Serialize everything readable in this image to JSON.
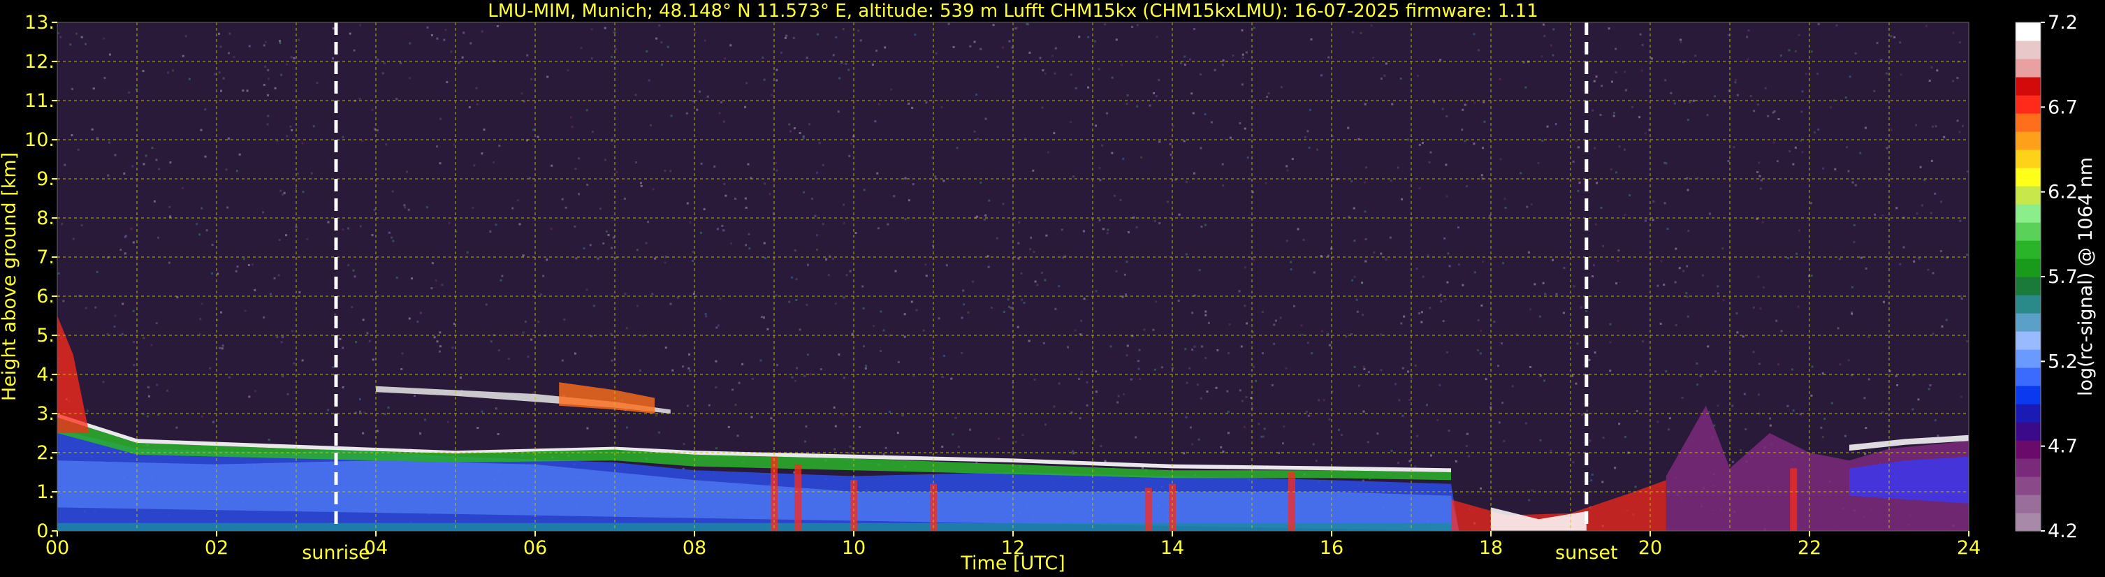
{
  "chart_data": {
    "type": "heatmap",
    "title": "LMU-MIM, Munich; 48.148° N 11.573° E, altitude: 539 m    Lufft CHM15kx (CHM15kxLMU): 16-07-2025    firmware: 1.11",
    "xlabel": "Time [UTC]",
    "ylabel": "Height above ground [km]",
    "xlim": [
      0,
      24
    ],
    "ylim": [
      0,
      13
    ],
    "x_ticks": [
      0,
      2,
      4,
      6,
      8,
      10,
      12,
      14,
      16,
      18,
      20,
      22,
      24
    ],
    "x_tick_labels": [
      "00",
      "02",
      "04",
      "06",
      "08",
      "10",
      "12",
      "14",
      "16",
      "18",
      "20",
      "22",
      "24"
    ],
    "y_ticks": [
      0,
      1,
      2,
      3,
      4,
      5,
      6,
      7,
      8,
      9,
      10,
      11,
      12,
      13
    ],
    "y_tick_labels": [
      "0.",
      "1.",
      "2.",
      "3.",
      "4.",
      "5.",
      "6.",
      "7.",
      "8.",
      "9.",
      "10.",
      "11.",
      "12.",
      "13."
    ],
    "grid": true,
    "markers": [
      {
        "label": "sunrise",
        "time": 3.5
      },
      {
        "label": "sunset",
        "time": 19.2
      }
    ],
    "colorbar": {
      "label": "log(rc-signal) @ 1064 nm",
      "range": [
        4.2,
        7.2
      ],
      "ticks": [
        4.2,
        4.7,
        5.2,
        5.7,
        6.2,
        6.7,
        7.2
      ],
      "tick_labels": [
        "4.2",
        "4.7",
        "5.2",
        "5.7",
        "6.2",
        "6.7",
        "7.2"
      ],
      "colors": [
        "#a88aa8",
        "#9a6e9a",
        "#8a4a8a",
        "#7a2a7a",
        "#6a0a6a",
        "#3a0a8a",
        "#1a1ab4",
        "#0a3af0",
        "#3a6aff",
        "#6a9aff",
        "#9abaff",
        "#5aa0c8",
        "#2a8a8a",
        "#1a7a3a",
        "#1a9a1a",
        "#2ab42a",
        "#5ad25a",
        "#8aee8a",
        "#c8e84a",
        "#ffff1a",
        "#ffd21a",
        "#ffa01a",
        "#ff6e1a",
        "#ff2a1a",
        "#d20a0a",
        "#e8a0a0",
        "#e8c8c8",
        "#ffffff"
      ]
    }
  },
  "colors": {
    "text": "#ffff33",
    "grid": "#c8c800",
    "background": "#000000",
    "marker": "#ffffff"
  }
}
